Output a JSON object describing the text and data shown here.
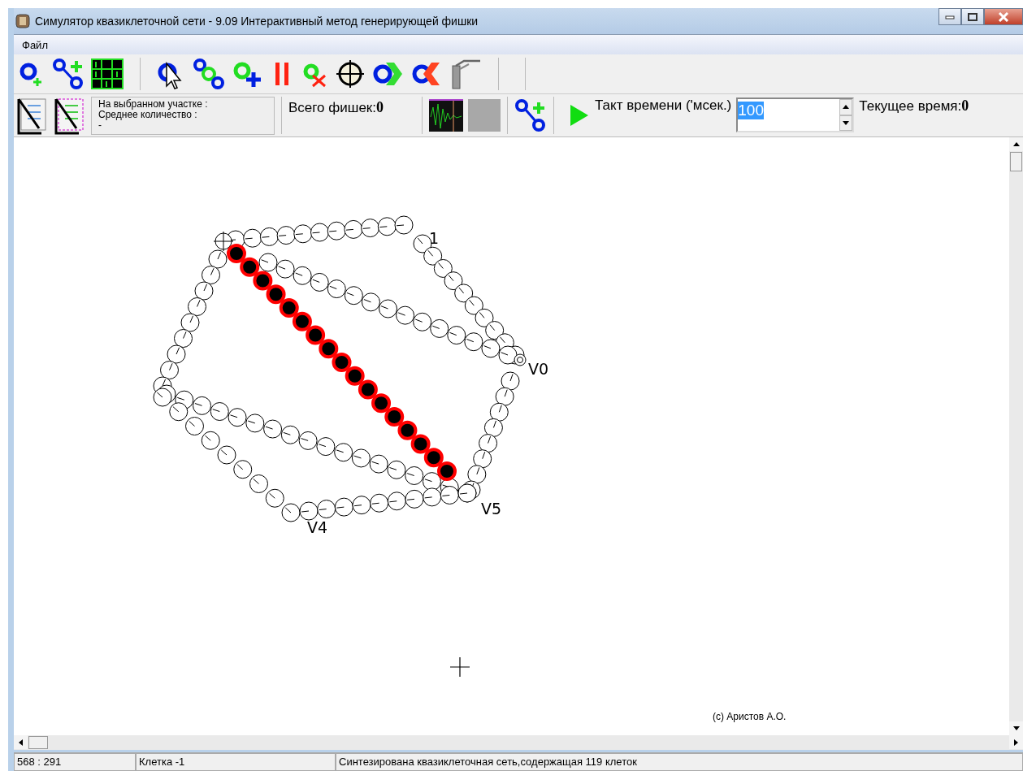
{
  "window": {
    "title": "Симулятор квазиклеточной сети - 9.09 Интерактивный метод генерирующей фишки"
  },
  "menu": [
    "Файл"
  ],
  "info_panel": {
    "lines": [
      "На выбранном участке :",
      "Среднее количество :",
      "-"
    ]
  },
  "total_chips": {
    "label": "Всего фишек:",
    "value": "0"
  },
  "time_step": {
    "label": "Такт времени ('мсек.)",
    "value": "100"
  },
  "current_time": {
    "label": "Текущее время:",
    "value": "0"
  },
  "canvas": {
    "vertex_labels": [
      "1",
      "V0",
      "V5",
      "V4"
    ],
    "copyright": "(c) Аристов А.О."
  },
  "status_bar": [
    "568 : 291",
    "Клетка -1",
    "Синтезирована квазиклеточная сеть,содержащая 119 клеток"
  ]
}
